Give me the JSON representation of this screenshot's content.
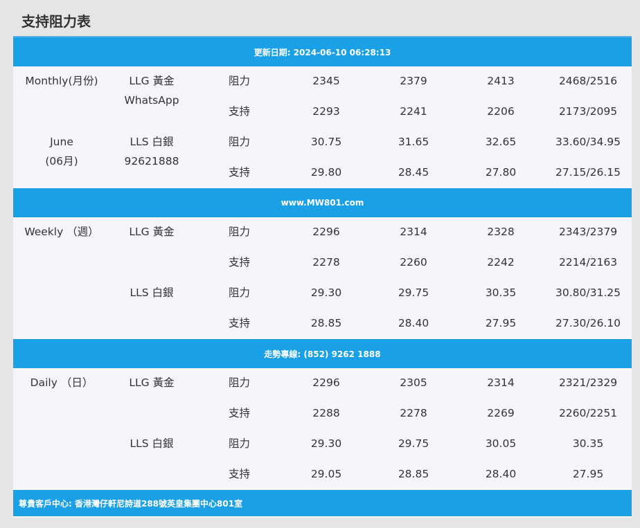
{
  "page_title": "支持阻力表",
  "update_band": "更新日期: 2024-06-10 06:28:13",
  "web_band": "www.MW801.com",
  "hotline_band": "走勢專線: (852) 9262 1888",
  "footer_band": "尊貴客戶中心: 香港灣仔軒尼詩道288號英皇集團中心801室",
  "monthly": {
    "period_lines": [
      "Monthly(月份)",
      "June",
      "(06月)"
    ],
    "contact_lines": [
      "WhatsApp",
      "92621888"
    ],
    "groups": [
      {
        "metal": "LLG 黃金",
        "rows": [
          {
            "kind": "阻力",
            "values": [
              "2345",
              "2379",
              "2413",
              "2468/2516"
            ]
          },
          {
            "kind": "支持",
            "values": [
              "2293",
              "2241",
              "2206",
              "2173/2095"
            ]
          }
        ]
      },
      {
        "metal": "LLS 白銀",
        "rows": [
          {
            "kind": "阻力",
            "values": [
              "30.75",
              "31.65",
              "32.65",
              "33.60/34.95"
            ]
          },
          {
            "kind": "支持",
            "values": [
              "29.80",
              "28.45",
              "27.80",
              "27.15/26.15"
            ]
          }
        ]
      }
    ]
  },
  "weekly": {
    "period_lines": [
      "Weekly （週）"
    ],
    "groups": [
      {
        "metal": "LLG 黃金",
        "rows": [
          {
            "kind": "阻力",
            "values": [
              "2296",
              "2314",
              "2328",
              "2343/2379"
            ]
          },
          {
            "kind": "支持",
            "values": [
              "2278",
              "2260",
              "2242",
              "2214/2163"
            ]
          }
        ]
      },
      {
        "metal": "LLS 白銀",
        "rows": [
          {
            "kind": "阻力",
            "values": [
              "29.30",
              "29.75",
              "30.35",
              "30.80/31.25"
            ]
          },
          {
            "kind": "支持",
            "values": [
              "28.85",
              "28.40",
              "27.95",
              "27.30/26.10"
            ]
          }
        ]
      }
    ]
  },
  "daily": {
    "period_lines": [
      "Daily （日）"
    ],
    "groups": [
      {
        "metal": "LLG 黃金",
        "rows": [
          {
            "kind": "阻力",
            "values": [
              "2296",
              "2305",
              "2314",
              "2321/2329"
            ]
          },
          {
            "kind": "支持",
            "values": [
              "2288",
              "2278",
              "2269",
              "2260/2251"
            ]
          }
        ]
      },
      {
        "metal": "LLS 白銀",
        "rows": [
          {
            "kind": "阻力",
            "values": [
              "29.30",
              "29.75",
              "30.05",
              "30.35"
            ]
          },
          {
            "kind": "支持",
            "values": [
              "29.05",
              "28.85",
              "28.40",
              "27.95"
            ]
          }
        ]
      }
    ]
  },
  "colors": {
    "band": "#1aa0e6",
    "panel": "#f5f6fa",
    "page": "#e6e6e6",
    "text": "#333333"
  }
}
